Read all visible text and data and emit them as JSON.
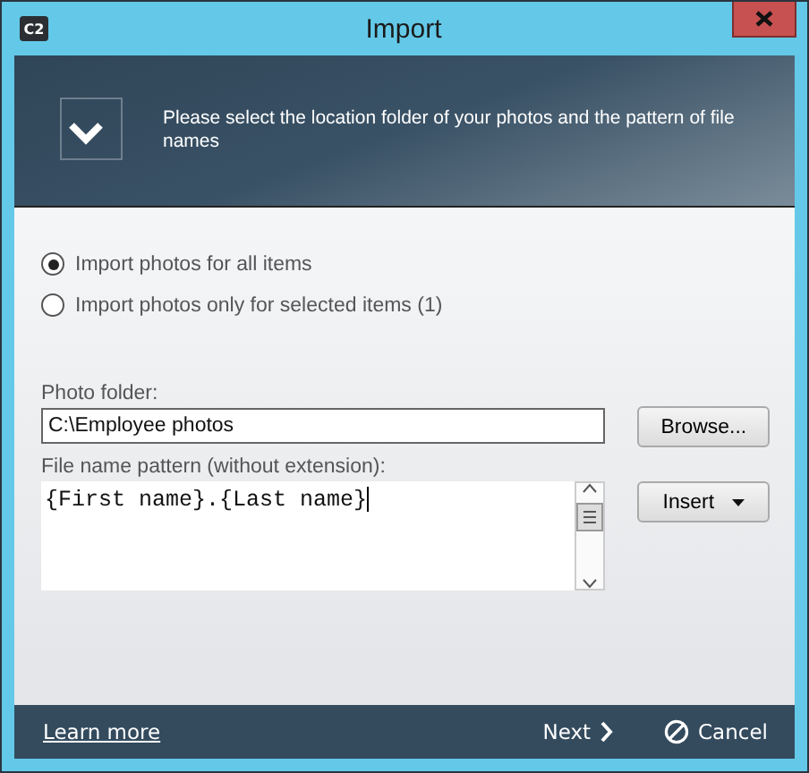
{
  "window": {
    "logo": "C2",
    "title": "Import"
  },
  "header": {
    "message": "Please select the location folder of your photos and the pattern of file names"
  },
  "options": [
    {
      "label": "Import photos for all items",
      "selected": true
    },
    {
      "label": "Import photos only for selected items (1)",
      "selected": false
    }
  ],
  "photo_folder": {
    "label": "Photo folder:",
    "value": "C:\\Employee photos",
    "button": "Browse..."
  },
  "pattern": {
    "label": "File name pattern (without extension):",
    "value": "{First name}.{Last name}",
    "button": "Insert"
  },
  "footer": {
    "link": "Learn more",
    "next": "Next",
    "cancel": "Cancel"
  }
}
